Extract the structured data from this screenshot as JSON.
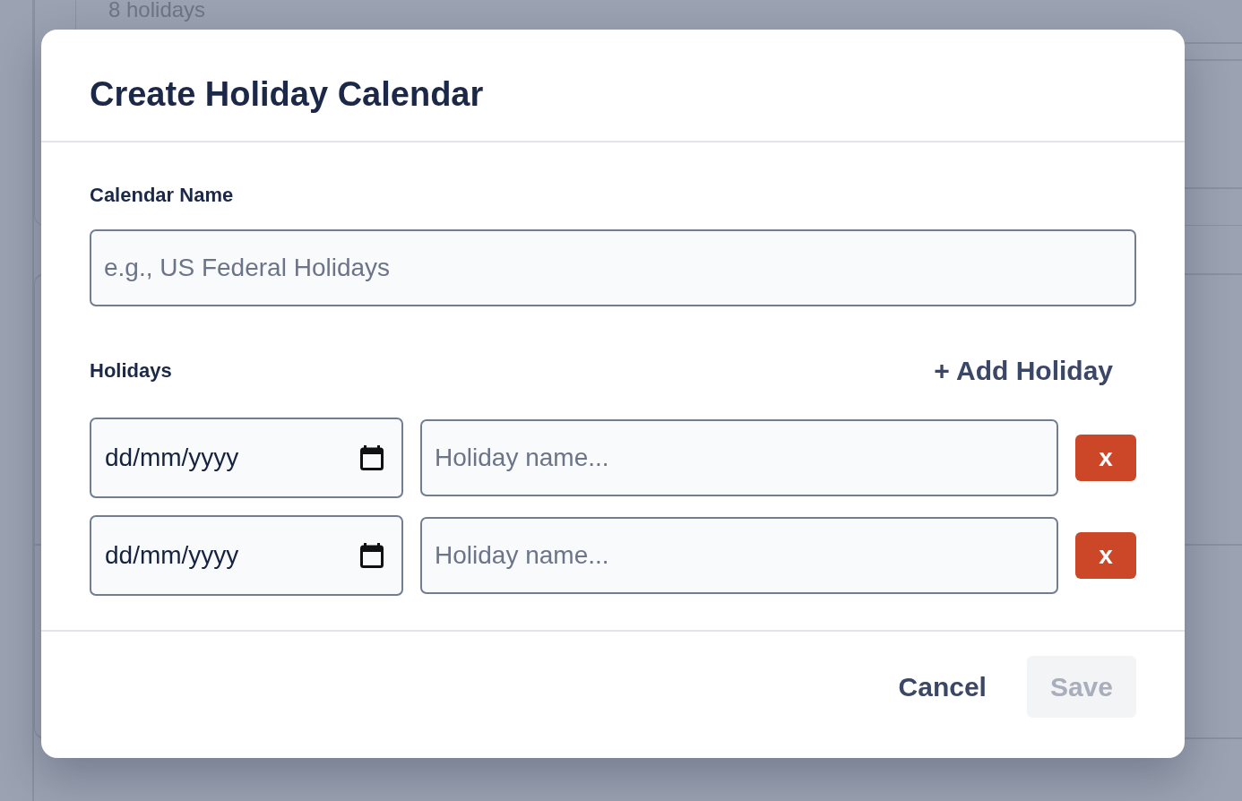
{
  "background": {
    "holiday_count": "8 holidays"
  },
  "dialog": {
    "title": "Create Holiday Calendar",
    "calendar_name": {
      "label": "Calendar Name",
      "placeholder": "e.g., US Federal Holidays"
    },
    "holidays": {
      "label": "Holidays",
      "add_button": "+ Add Holiday",
      "rows": [
        {
          "date": {
            "placeholder": "dd/mm/yyyy"
          },
          "name": {
            "placeholder": "Holiday name..."
          },
          "remove_button": "x"
        },
        {
          "date": {
            "placeholder": "dd/mm/yyyy"
          },
          "name": {
            "placeholder": "Holiday name..."
          },
          "remove_button": "x"
        }
      ]
    },
    "buttons": [
      {
        "label": "Cancel",
        "kind": "text",
        "disabled": false
      },
      {
        "label": "Save",
        "kind": "filled",
        "disabled": true
      }
    ]
  }
}
